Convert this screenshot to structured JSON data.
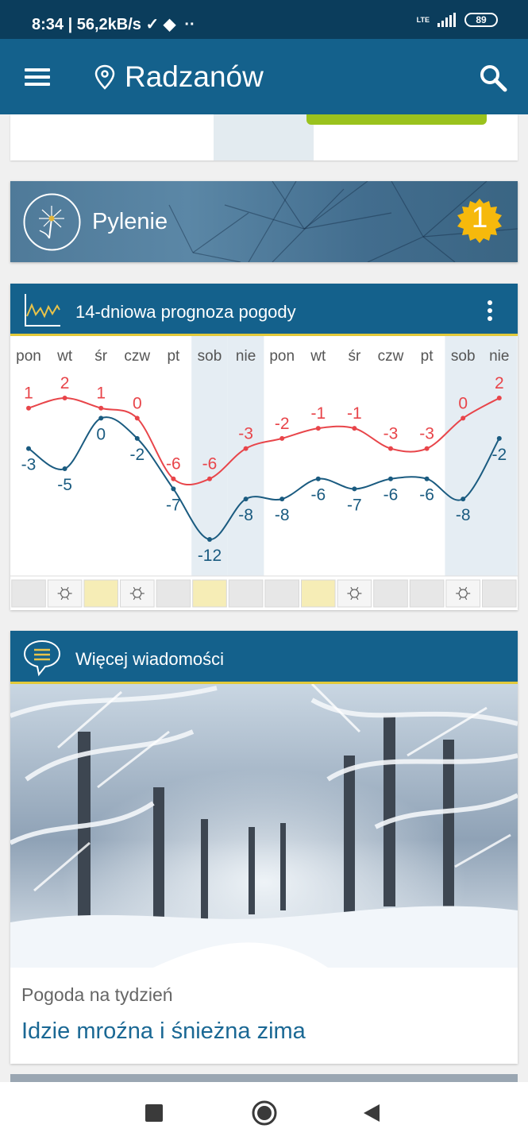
{
  "status_bar": {
    "time_speed": "8:34 | 56,2kB/s",
    "network": "LTE",
    "battery": "89"
  },
  "app_bar": {
    "title": "Radzanów"
  },
  "pollen": {
    "title": "Pylenie",
    "level": "1"
  },
  "forecast": {
    "title": "14-dniowa prognoza pogody",
    "days": [
      "pon",
      "wt",
      "śr",
      "czw",
      "pt",
      "sob",
      "nie",
      "pon",
      "wt",
      "śr",
      "czw",
      "pt",
      "sob",
      "nie"
    ],
    "weekend_indices": [
      5,
      6,
      12,
      13
    ],
    "precip": [
      "none",
      "snow",
      "sun",
      "snow",
      "none",
      "sun",
      "none",
      "none",
      "sun",
      "snow",
      "none",
      "none",
      "snow",
      "none"
    ]
  },
  "chart_data": {
    "type": "line",
    "categories": [
      "pon",
      "wt",
      "śr",
      "czw",
      "pt",
      "sob",
      "nie",
      "pon",
      "wt",
      "śr",
      "czw",
      "pt",
      "sob",
      "nie"
    ],
    "series": [
      {
        "values": [
          1,
          2,
          1,
          0,
          -6,
          -6,
          -3,
          -2,
          -1,
          -1,
          -3,
          -3,
          0,
          2
        ],
        "color": "#e8454a"
      },
      {
        "values": [
          -3,
          -5,
          0,
          -2,
          -7,
          -12,
          -8,
          -8,
          -6,
          -7,
          -6,
          -6,
          -8,
          -2
        ],
        "color": "#1a5b80"
      }
    ],
    "ylim": [
      -12,
      2
    ],
    "grid": false
  },
  "news": {
    "title": "Więcej wiadomości",
    "kicker": "Pogoda na tydzień",
    "headline": "Idzie mroźna i śnieżna zima"
  },
  "colors": {
    "primary": "#14618c",
    "accent": "#e2c93a",
    "high": "#e8454a",
    "low": "#1a5b80"
  }
}
